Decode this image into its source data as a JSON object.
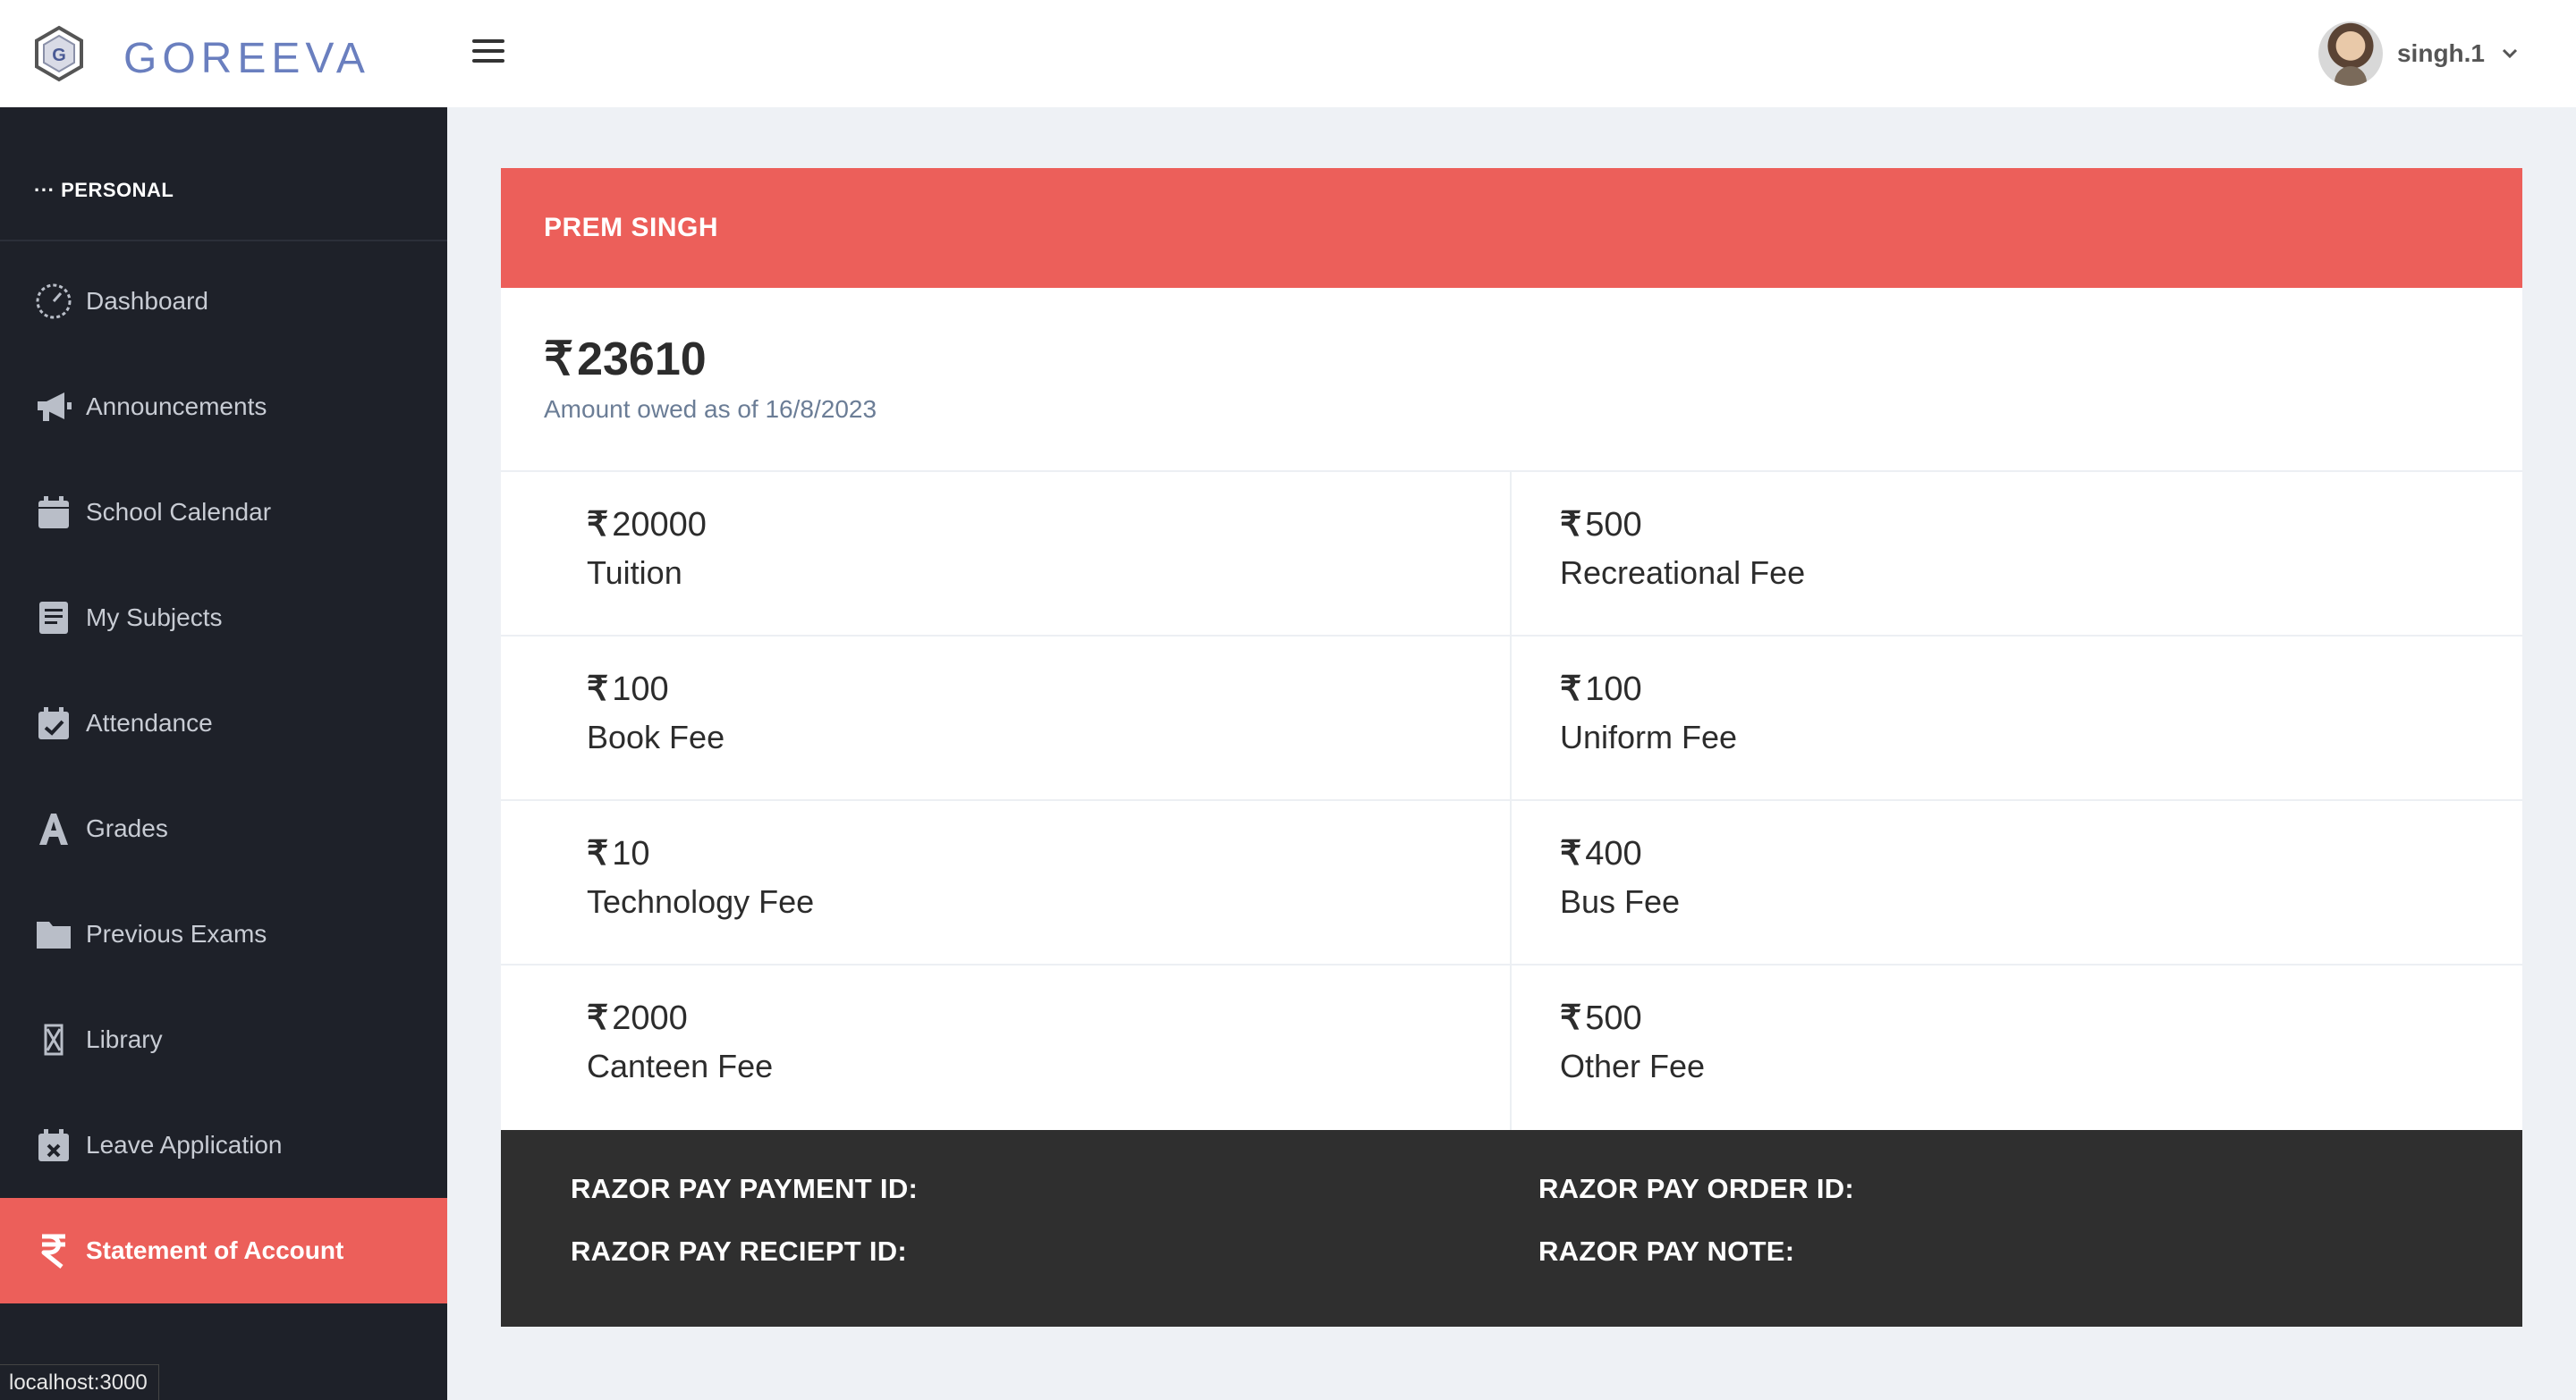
{
  "header": {
    "brand": "GOREEVA",
    "username": "singh.1"
  },
  "sidebar": {
    "section_label": "PERSONAL",
    "items": [
      {
        "label": "Dashboard",
        "icon": "dashboard-gauge-icon"
      },
      {
        "label": "Announcements",
        "icon": "megaphone-icon"
      },
      {
        "label": "School Calendar",
        "icon": "calendar-icon"
      },
      {
        "label": "My Subjects",
        "icon": "book-icon"
      },
      {
        "label": "Attendance",
        "icon": "calendar-check-icon"
      },
      {
        "label": "Grades",
        "icon": "letter-a-icon"
      },
      {
        "label": "Previous Exams",
        "icon": "folder-icon"
      },
      {
        "label": "Library",
        "icon": "hourglass-icon"
      },
      {
        "label": "Leave Application",
        "icon": "calendar-x-icon"
      },
      {
        "label": "Statement of Account",
        "icon": "rupee-icon",
        "active": true
      }
    ]
  },
  "statement": {
    "student_name": "PREM SINGH",
    "currency_symbol": "₹",
    "total_owed": "23610",
    "as_of_text": "Amount owed as of 16/8/2023",
    "fees": [
      {
        "amount": "20000",
        "name": "Tuition"
      },
      {
        "amount": "500",
        "name": "Recreational Fee"
      },
      {
        "amount": "100",
        "name": "Book Fee"
      },
      {
        "amount": "100",
        "name": "Uniform Fee"
      },
      {
        "amount": "10",
        "name": "Technology Fee"
      },
      {
        "amount": "400",
        "name": "Bus Fee"
      },
      {
        "amount": "2000",
        "name": "Canteen Fee"
      },
      {
        "amount": "500",
        "name": "Other Fee"
      }
    ]
  },
  "payment": {
    "payment_id_label": "RAZOR PAY PAYMENT ID:",
    "order_id_label": "RAZOR PAY ORDER ID:",
    "receipt_id_label": "RAZOR PAY RECIEPT ID:",
    "note_label": "RAZOR PAY NOTE:"
  },
  "status_bar": {
    "url": "localhost:3000"
  },
  "colors": {
    "accent": "#ec5f5a",
    "sidebar_bg": "#1e2129",
    "page_bg": "#eef1f5",
    "payment_bg": "#2f2f2f",
    "brand": "#6a7fbf"
  }
}
